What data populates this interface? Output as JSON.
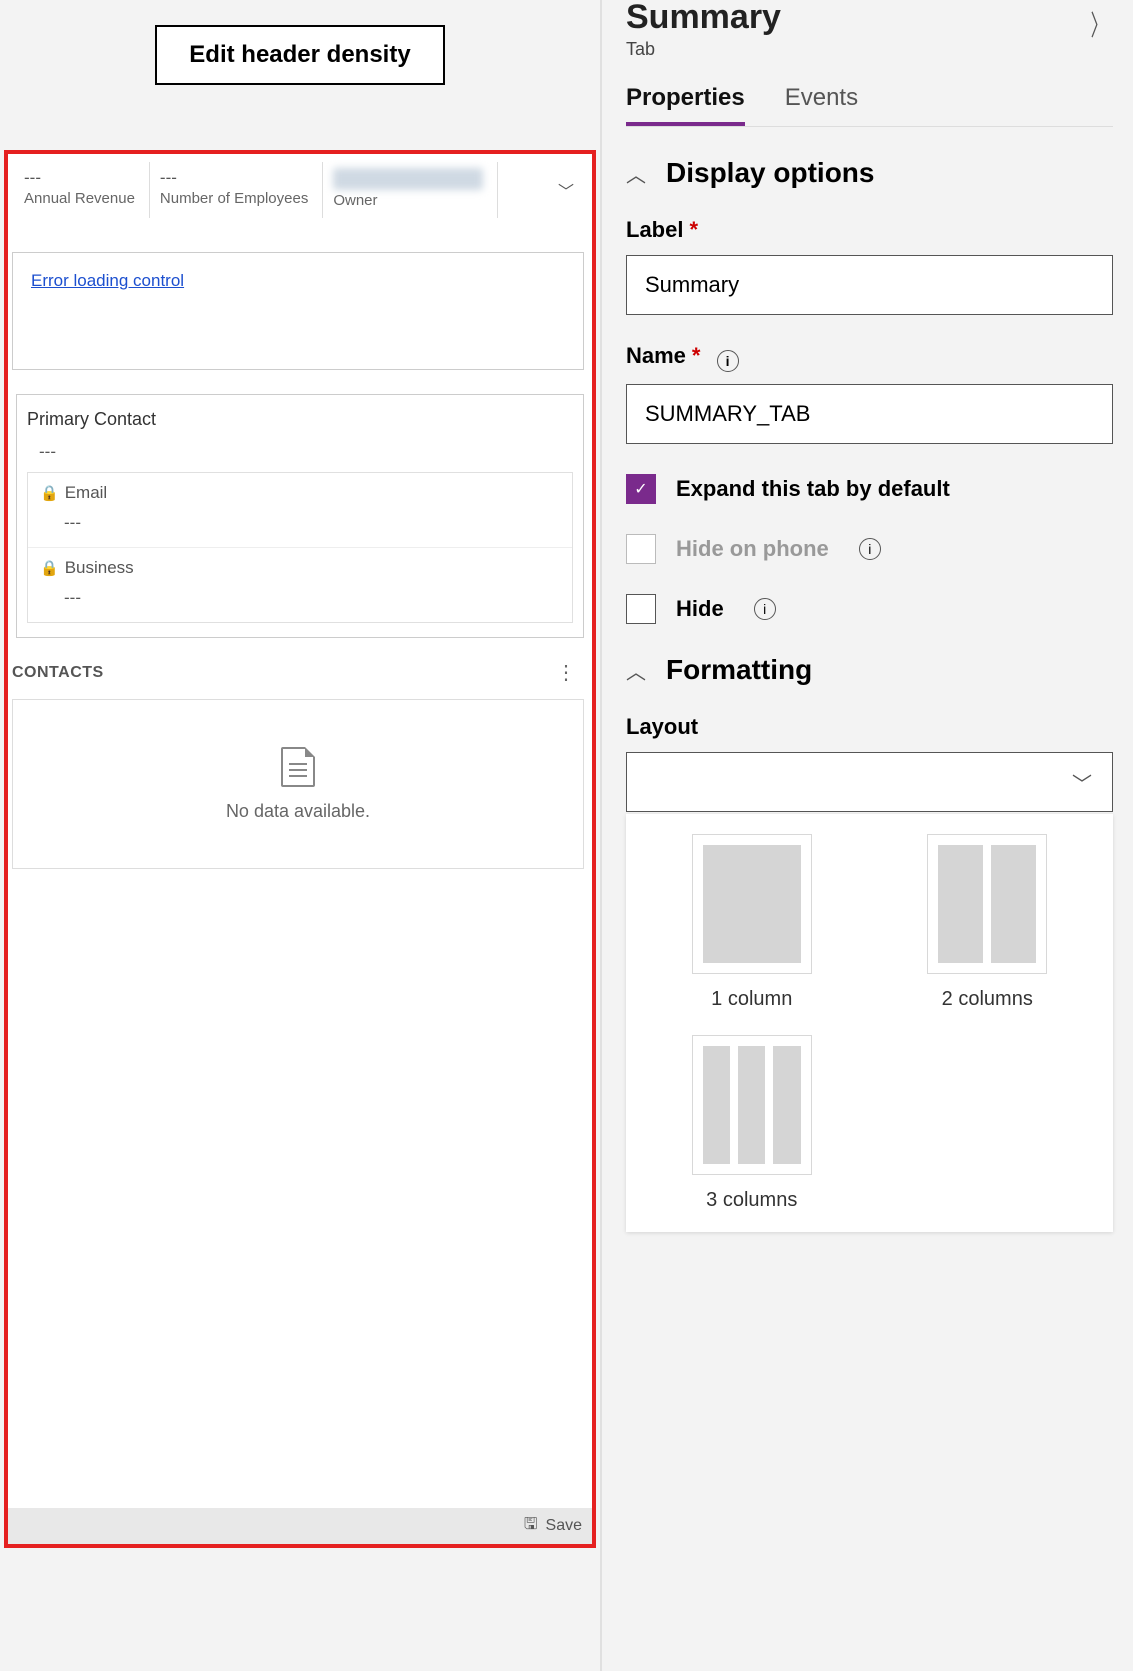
{
  "left": {
    "edit_button": "Edit header density",
    "header_fields": [
      {
        "value": "---",
        "label": "Annual Revenue"
      },
      {
        "value": "---",
        "label": "Number of Employees"
      },
      {
        "value": "",
        "label": "Owner"
      }
    ],
    "error_link": "Error loading control",
    "primary_contact": {
      "label": "Primary Contact",
      "value": "---"
    },
    "fields": [
      {
        "label": "Email",
        "value": "---"
      },
      {
        "label": "Business",
        "value": "---"
      }
    ],
    "contacts_section": "CONTACTS",
    "empty_text": "No data available.",
    "save": "Save"
  },
  "right": {
    "title": "Summary",
    "subtitle": "Tab",
    "tabs": {
      "properties": "Properties",
      "events": "Events"
    },
    "display_options": {
      "heading": "Display options",
      "label_field": "Label",
      "label_value": "Summary",
      "name_field": "Name",
      "name_value": "SUMMARY_TAB",
      "expand": "Expand this tab by default",
      "hide_phone": "Hide on phone",
      "hide": "Hide"
    },
    "formatting": {
      "heading": "Formatting",
      "layout_label": "Layout",
      "options": {
        "c1": "1 column",
        "c2": "2 columns",
        "c3": "3 columns"
      }
    }
  }
}
